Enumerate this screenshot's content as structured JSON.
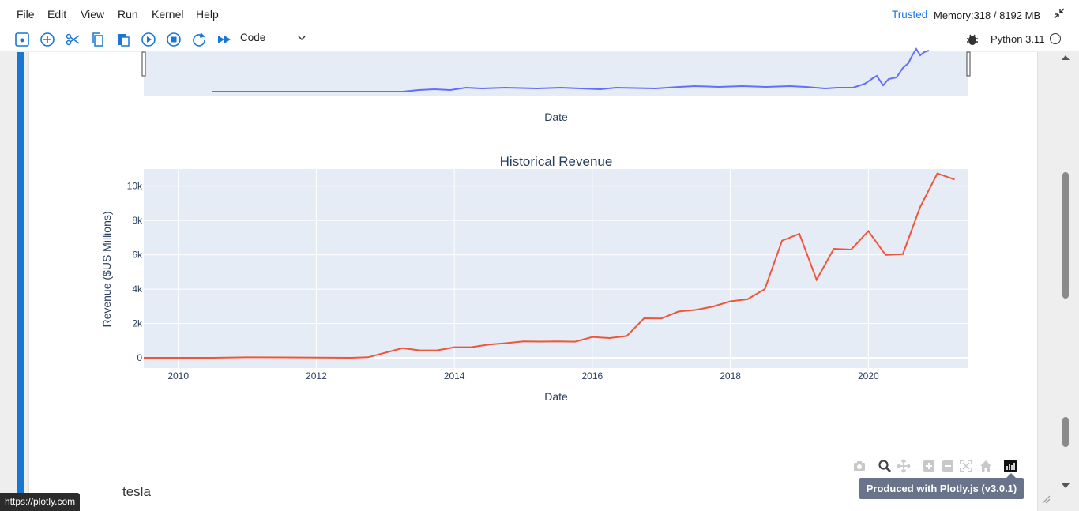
{
  "menu": {
    "items": [
      "File",
      "Edit",
      "View",
      "Run",
      "Kernel",
      "Help"
    ],
    "trusted": "Trusted",
    "memory": "Memory:318 / 8192 MB"
  },
  "toolbar": {
    "cell_type": "Code",
    "kernel": "Python 3.11"
  },
  "status_url": "https://plotly.com",
  "next_cell_text": "tesla",
  "plotly": {
    "tooltip": "Produced with Plotly.js (v3.0.1)",
    "modebar_icons": [
      "camera-icon",
      "zoom-icon",
      "pan-icon",
      "zoom-in-icon",
      "zoom-out-icon",
      "autoscale-icon",
      "reset-axes-icon",
      "plotly-logo-icon"
    ]
  },
  "top_chart": {
    "xlabel": "Date"
  },
  "chart_data": {
    "type": "line",
    "title": "Historical Revenue",
    "xlabel": "Date",
    "ylabel": "Revenue ($US Millions)",
    "x_ticks": [
      "2010",
      "2012",
      "2014",
      "2016",
      "2018",
      "2020"
    ],
    "y_ticks": [
      "0",
      "2k",
      "4k",
      "6k",
      "8k",
      "10k"
    ],
    "xlim": [
      2009.5,
      2021.45
    ],
    "ylim": [
      -600,
      11000
    ],
    "line_color": "#ef553b",
    "grid": true,
    "series": [
      {
        "x": [
          2009.5,
          2010.0,
          2010.5,
          2011.0,
          2011.5,
          2012.0,
          2012.5,
          2012.75,
          2013.25,
          2013.5,
          2013.75,
          2014.0,
          2014.25,
          2014.5,
          2014.75,
          2015.0,
          2015.25,
          2015.5,
          2015.75,
          2016.0,
          2016.25,
          2016.5,
          2016.75,
          2017.0,
          2017.25,
          2017.5,
          2017.75,
          2018.0,
          2018.25,
          2018.5,
          2018.75,
          2019.0,
          2019.25,
          2019.5,
          2019.75,
          2020.0,
          2020.25,
          2020.5,
          2020.75,
          2021.0,
          2021.25
        ],
        "y": [
          0,
          0,
          0,
          28,
          20,
          10,
          0,
          30,
          562,
          431,
          433,
          615,
          620,
          769,
          852,
          956,
          940,
          955,
          937,
          1214,
          1147,
          1270,
          2298,
          2285,
          2696,
          2790,
          2985,
          3288,
          3409,
          4002,
          6824,
          7226,
          4541,
          6350,
          6303,
          7384,
          5985,
          6036,
          8771,
          10744,
          10389
        ]
      }
    ]
  }
}
